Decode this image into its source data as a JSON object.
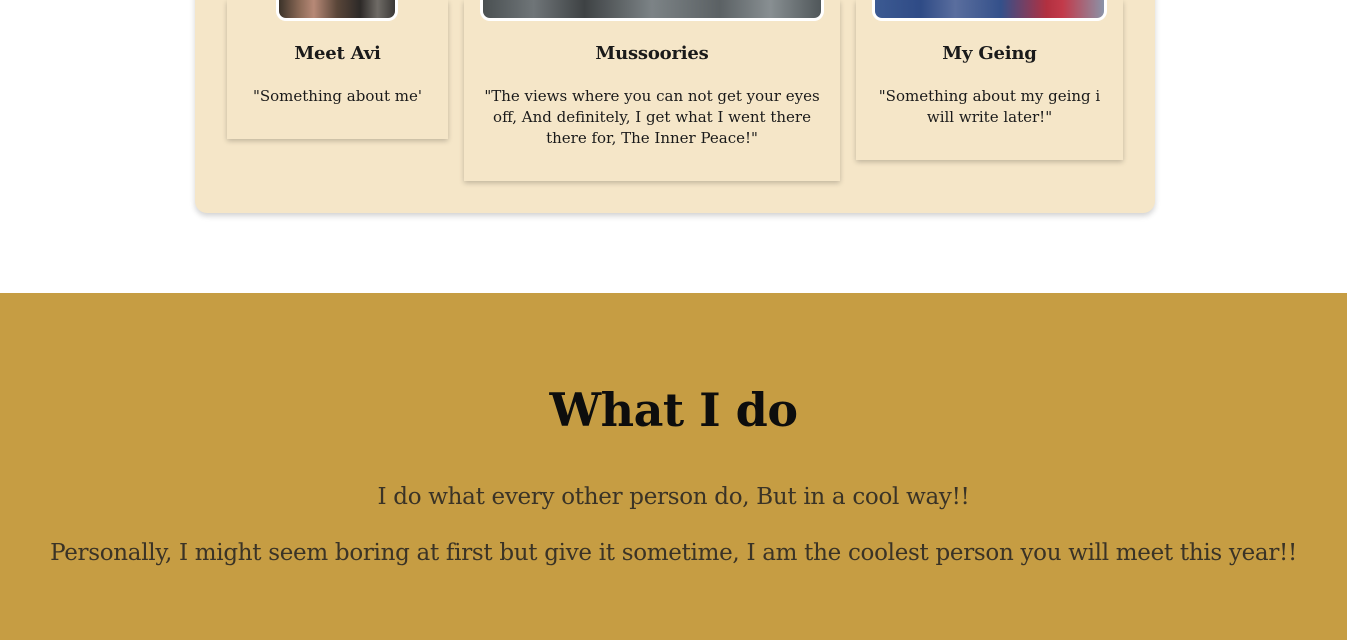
{
  "cards": [
    {
      "title": "Meet Avi",
      "text": "\"Something about me'",
      "image": "avi-photo"
    },
    {
      "title": "Mussoories",
      "text": "\"The views where you can not get your eyes off, And definitely, I get what I went there there for, The Inner Peace!\"",
      "image": "mussoorie-photo"
    },
    {
      "title": "My Geing",
      "text": "\"Something about my geing i will write later!\"",
      "image": "group-photo"
    }
  ],
  "what_i_do": {
    "heading": "What I do",
    "line1": "I do what every other person do, But in a cool way!!",
    "line2": "Personally, I might seem boring at first but give it sometime, I am the coolest person you will meet this year!!"
  },
  "colors": {
    "panel": "#f5e6c8",
    "section_bg": "#c69d43"
  }
}
